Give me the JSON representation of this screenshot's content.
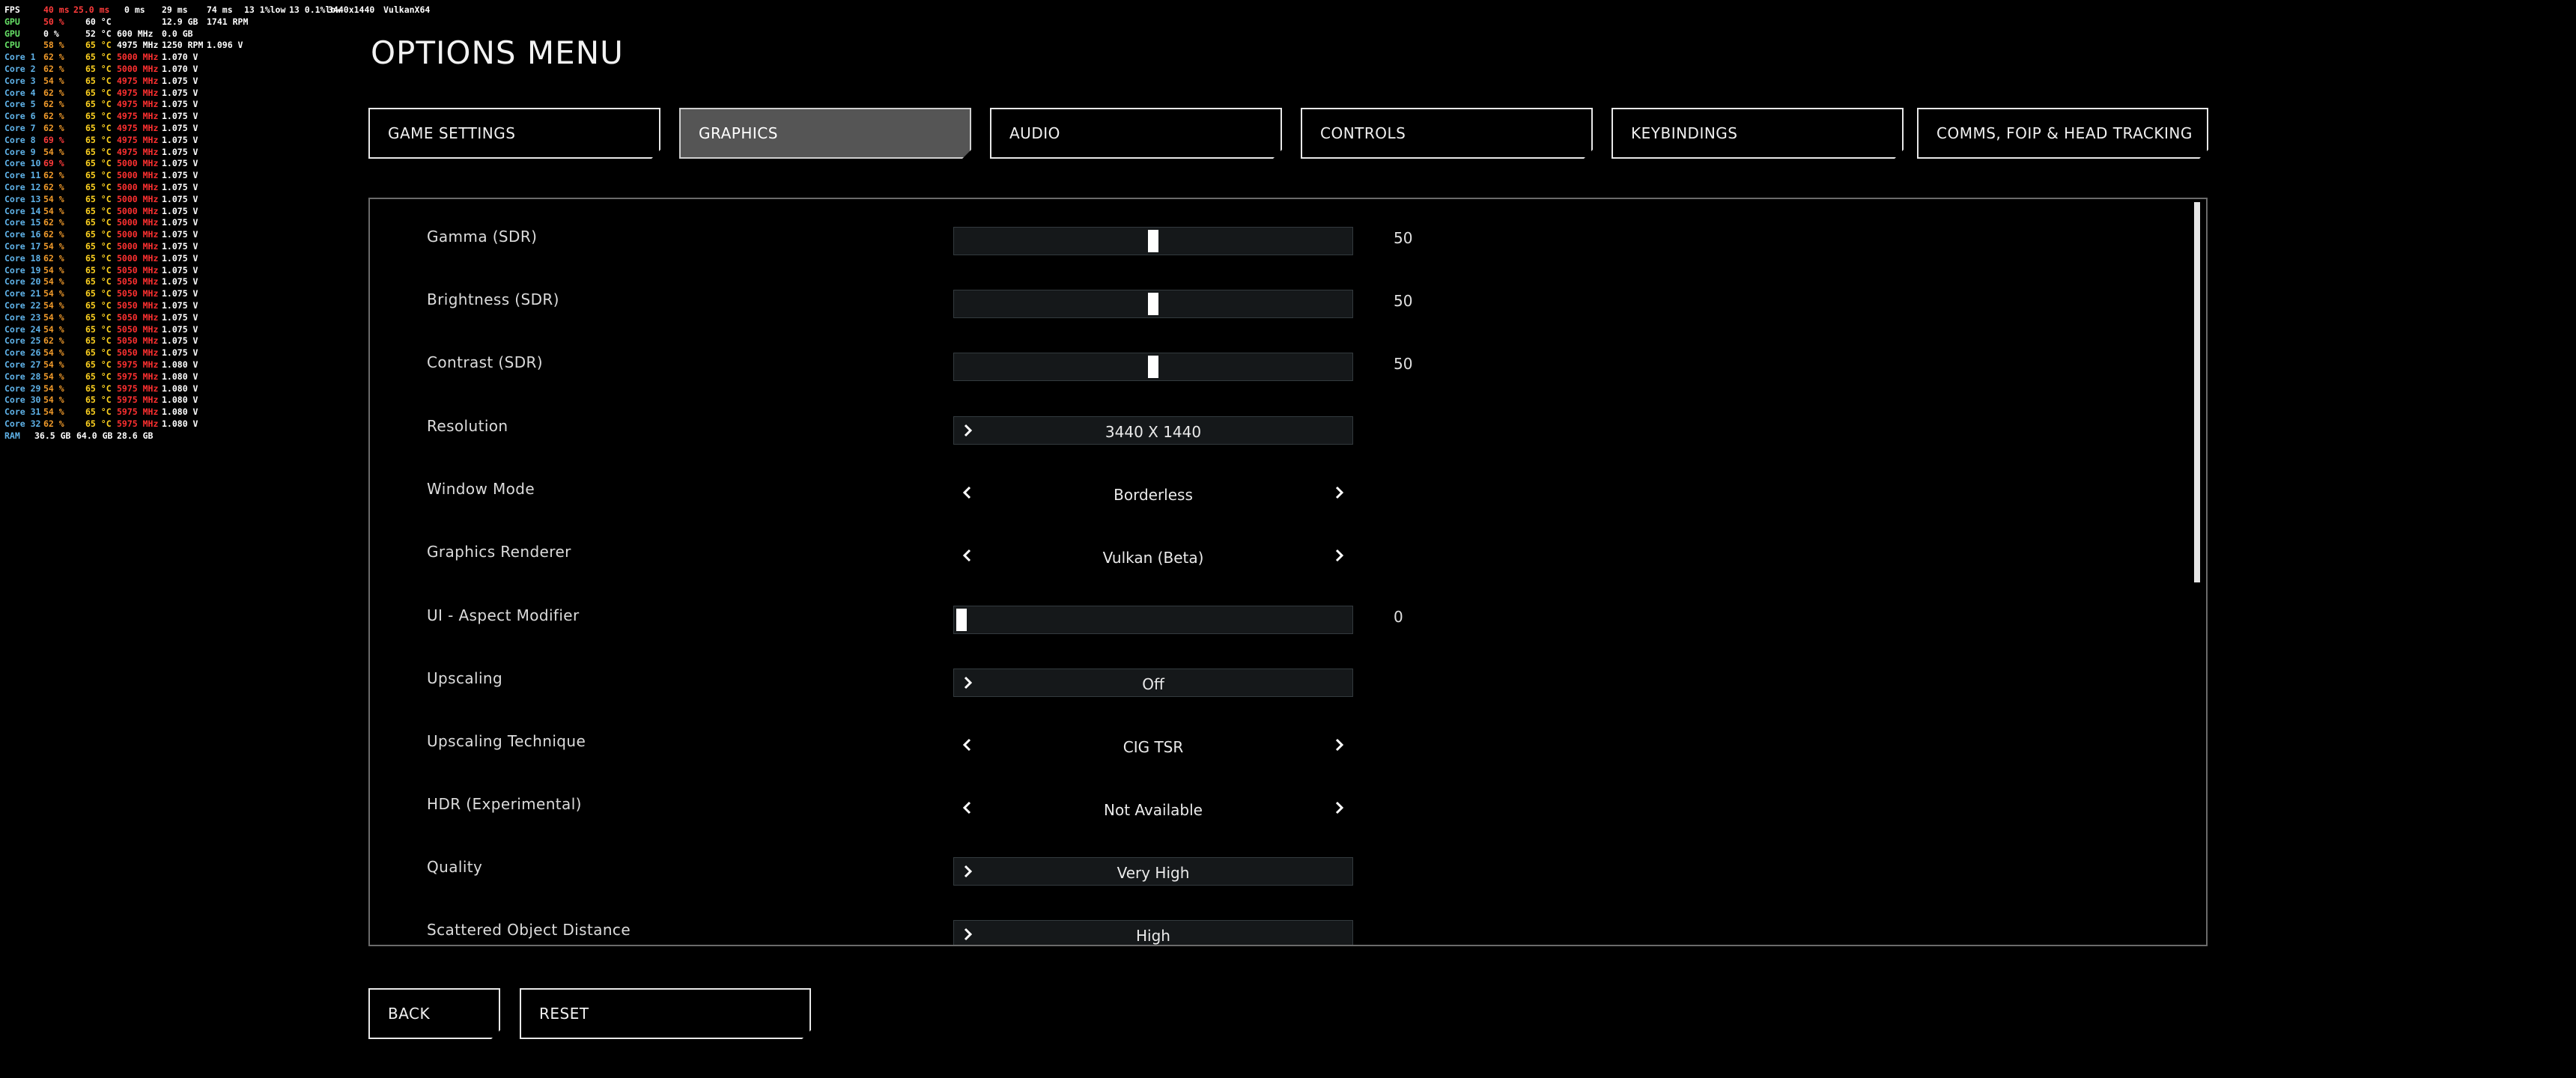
{
  "perf": {
    "header": {
      "fps_label": "FPS",
      "fps_value": "40 ms",
      "frametime": "25.0 ms",
      "a": "0 ms",
      "b": "29 ms",
      "c": "74 ms",
      "d": "13 1%low",
      "e": "13 0.1%low",
      "resolution": "3440x1440",
      "api": "VulkanX64"
    },
    "gpu1": {
      "label": "GPU",
      "load": "50 %",
      "temp": "60 °C",
      "clock": "",
      "volt": "12.9 GB",
      "extra": "1741 RPM"
    },
    "gpu2": {
      "label": "GPU",
      "load": "0 %",
      "temp": "52 °C",
      "clock": "600 MHz",
      "volt": "0.0 GB",
      "extra": ""
    },
    "cpu": {
      "label": "CPU",
      "load": "58 %",
      "temp": "65 °C",
      "clock": "4975 MHz",
      "volt": "1250 RPM",
      "extra": "1.096 V"
    },
    "cores": [
      {
        "label": "Core 1",
        "load": "62 %",
        "temp": "65 °C",
        "clock": "5000 MHz",
        "volt": "1.070 V"
      },
      {
        "label": "Core 2",
        "load": "62 %",
        "temp": "65 °C",
        "clock": "5000 MHz",
        "volt": "1.070 V"
      },
      {
        "label": "Core 3",
        "load": "54 %",
        "temp": "65 °C",
        "clock": "4975 MHz",
        "volt": "1.075 V"
      },
      {
        "label": "Core 4",
        "load": "62 %",
        "temp": "65 °C",
        "clock": "4975 MHz",
        "volt": "1.075 V"
      },
      {
        "label": "Core 5",
        "load": "62 %",
        "temp": "65 °C",
        "clock": "4975 MHz",
        "volt": "1.075 V"
      },
      {
        "label": "Core 6",
        "load": "62 %",
        "temp": "65 °C",
        "clock": "4975 MHz",
        "volt": "1.075 V"
      },
      {
        "label": "Core 7",
        "load": "62 %",
        "temp": "65 °C",
        "clock": "4975 MHz",
        "volt": "1.075 V"
      },
      {
        "label": "Core 8",
        "load": "69 %",
        "temp": "65 °C",
        "clock": "4975 MHz",
        "volt": "1.075 V"
      },
      {
        "label": "Core 9",
        "load": "54 %",
        "temp": "65 °C",
        "clock": "4975 MHz",
        "volt": "1.075 V"
      },
      {
        "label": "Core 10",
        "load": "69 %",
        "temp": "65 °C",
        "clock": "5000 MHz",
        "volt": "1.075 V"
      },
      {
        "label": "Core 11",
        "load": "62 %",
        "temp": "65 °C",
        "clock": "5000 MHz",
        "volt": "1.075 V"
      },
      {
        "label": "Core 12",
        "load": "62 %",
        "temp": "65 °C",
        "clock": "5000 MHz",
        "volt": "1.075 V"
      },
      {
        "label": "Core 13",
        "load": "54 %",
        "temp": "65 °C",
        "clock": "5000 MHz",
        "volt": "1.075 V"
      },
      {
        "label": "Core 14",
        "load": "54 %",
        "temp": "65 °C",
        "clock": "5000 MHz",
        "volt": "1.075 V"
      },
      {
        "label": "Core 15",
        "load": "62 %",
        "temp": "65 °C",
        "clock": "5000 MHz",
        "volt": "1.075 V"
      },
      {
        "label": "Core 16",
        "load": "62 %",
        "temp": "65 °C",
        "clock": "5000 MHz",
        "volt": "1.075 V"
      },
      {
        "label": "Core 17",
        "load": "54 %",
        "temp": "65 °C",
        "clock": "5000 MHz",
        "volt": "1.075 V"
      },
      {
        "label": "Core 18",
        "load": "62 %",
        "temp": "65 °C",
        "clock": "5000 MHz",
        "volt": "1.075 V"
      },
      {
        "label": "Core 19",
        "load": "54 %",
        "temp": "65 °C",
        "clock": "5050 MHz",
        "volt": "1.075 V"
      },
      {
        "label": "Core 20",
        "load": "54 %",
        "temp": "65 °C",
        "clock": "5050 MHz",
        "volt": "1.075 V"
      },
      {
        "label": "Core 21",
        "load": "54 %",
        "temp": "65 °C",
        "clock": "5050 MHz",
        "volt": "1.075 V"
      },
      {
        "label": "Core 22",
        "load": "54 %",
        "temp": "65 °C",
        "clock": "5050 MHz",
        "volt": "1.075 V"
      },
      {
        "label": "Core 23",
        "load": "54 %",
        "temp": "65 °C",
        "clock": "5050 MHz",
        "volt": "1.075 V"
      },
      {
        "label": "Core 24",
        "load": "54 %",
        "temp": "65 °C",
        "clock": "5050 MHz",
        "volt": "1.075 V"
      },
      {
        "label": "Core 25",
        "load": "62 %",
        "temp": "65 °C",
        "clock": "5050 MHz",
        "volt": "1.075 V"
      },
      {
        "label": "Core 26",
        "load": "54 %",
        "temp": "65 °C",
        "clock": "5050 MHz",
        "volt": "1.075 V"
      },
      {
        "label": "Core 27",
        "load": "54 %",
        "temp": "65 °C",
        "clock": "5975 MHz",
        "volt": "1.080 V"
      },
      {
        "label": "Core 28",
        "load": "54 %",
        "temp": "65 °C",
        "clock": "5975 MHz",
        "volt": "1.080 V"
      },
      {
        "label": "Core 29",
        "load": "54 %",
        "temp": "65 °C",
        "clock": "5975 MHz",
        "volt": "1.080 V"
      },
      {
        "label": "Core 30",
        "load": "54 %",
        "temp": "65 °C",
        "clock": "5975 MHz",
        "volt": "1.080 V"
      },
      {
        "label": "Core 31",
        "load": "54 %",
        "temp": "65 °C",
        "clock": "5975 MHz",
        "volt": "1.080 V"
      },
      {
        "label": "Core 32",
        "load": "62 %",
        "temp": "65 °C",
        "clock": "5975 MHz",
        "volt": "1.080 V"
      }
    ],
    "ram": {
      "label": "RAM",
      "used": "36.5 GB",
      "total": "64.0 GB",
      "free": "28.6 GB"
    }
  },
  "title": "OPTIONS MENU",
  "tabs": [
    {
      "label": "GAME SETTINGS"
    },
    {
      "label": "GRAPHICS",
      "active": true
    },
    {
      "label": "AUDIO"
    },
    {
      "label": "CONTROLS"
    },
    {
      "label": "KEYBINDINGS"
    },
    {
      "label": "COMMS, FOIP & HEAD TRACKING"
    }
  ],
  "settings": {
    "gamma": {
      "label": "Gamma (SDR)",
      "value": "50",
      "level": 0.5
    },
    "brightness": {
      "label": "Brightness (SDR)",
      "value": "50",
      "level": 0.5
    },
    "contrast": {
      "label": "Contrast (SDR)",
      "value": "50",
      "level": 0.5
    },
    "resolution": {
      "label": "Resolution",
      "value": "3440 X 1440"
    },
    "window_mode": {
      "label": "Window Mode",
      "value": "Borderless"
    },
    "renderer": {
      "label": "Graphics Renderer",
      "value": "Vulkan (Beta)"
    },
    "aspect": {
      "label": "UI - Aspect Modifier",
      "value": "0",
      "level": 0
    },
    "upscaling": {
      "label": "Upscaling",
      "value": "Off"
    },
    "upscaling_technique": {
      "label": "Upscaling Technique",
      "value": "CIG TSR"
    },
    "hdr": {
      "label": "HDR (Experimental)",
      "value": "Not Available"
    },
    "quality": {
      "label": "Quality",
      "value": "Very High"
    },
    "scattered": {
      "label": "Scattered Object Distance",
      "value": "High"
    }
  },
  "buttons": {
    "back": "BACK",
    "reset": "RESET"
  },
  "colors": {
    "accent": "#e8e8e8",
    "active_tab": "#555555",
    "panel_border": "#6a6a6a",
    "field_bg": "#15181a"
  }
}
